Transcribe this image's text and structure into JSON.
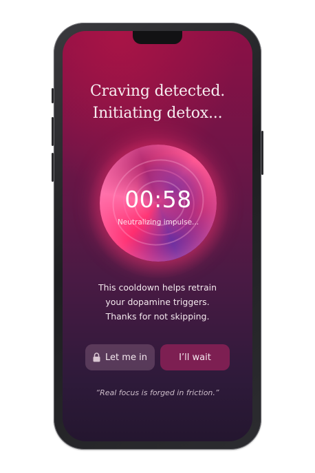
{
  "headline": {
    "line1": "Craving detected.",
    "line2": "Initiating detox..."
  },
  "timer": {
    "value": "00:58",
    "status": "Neutralizing impulse..."
  },
  "message": {
    "line1": "This cooldown helps retrain",
    "line2": "your dopamine triggers.",
    "line3": "Thanks for not skipping."
  },
  "actions": {
    "let_me_in": {
      "label": "Let me in",
      "icon": "lock-icon"
    },
    "wait": {
      "label": "I’ll wait"
    }
  },
  "quote": "“Real focus is forged in friction.”",
  "colors": {
    "accent": "#7d1f52",
    "background_top": "#8c1046",
    "background_bottom": "#24162f",
    "orb": "#ff4f8a"
  }
}
